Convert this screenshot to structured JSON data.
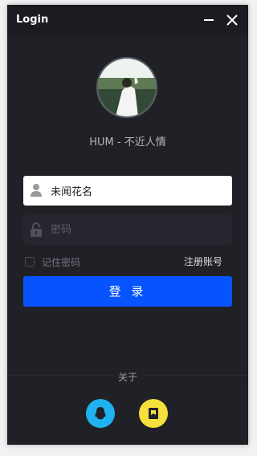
{
  "window": {
    "title": "Login"
  },
  "profile": {
    "display_name": "HUM - 不近人情"
  },
  "form": {
    "username_value": "未闻花名",
    "password_placeholder": "密码",
    "remember_label": "记住密码",
    "register_label": "注册账号",
    "login_label": "登 录"
  },
  "footer": {
    "about_label": "关于"
  },
  "colors": {
    "accent": "#0754fe",
    "qq": "#1eb3f0",
    "second_social": "#f6e13c"
  }
}
